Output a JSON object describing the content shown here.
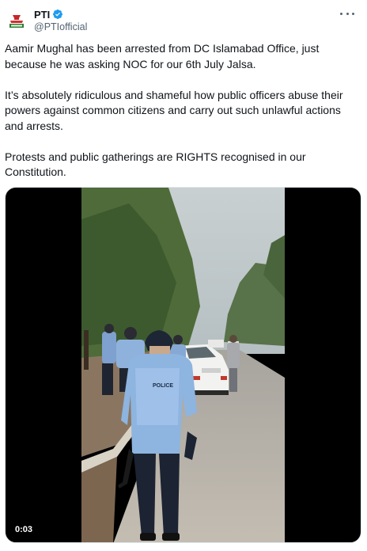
{
  "account": {
    "display_name": "PTI",
    "handle": "@PTIofficial",
    "verified": true,
    "avatar_icon": "pti-logo-icon"
  },
  "menu": {
    "icon": "more-options-icon"
  },
  "tweet": {
    "paragraphs": [
      "Aamir Mughal has been arrested from DC Islamabad Office, just because he was asking NOC for our 6th July Jalsa.",
      "It’s absolutely ridiculous and shameful how public officers abuse their powers against common citizens and carry out such unlawful actions and arrests.",
      "Protests and public gatherings are RIGHTS recognised in our Constitution."
    ]
  },
  "video": {
    "duration": "0:03",
    "uniform_label": "POLICE"
  },
  "colors": {
    "text": "#0f1419",
    "secondary": "#536471",
    "verified": "#1d9bf0"
  }
}
